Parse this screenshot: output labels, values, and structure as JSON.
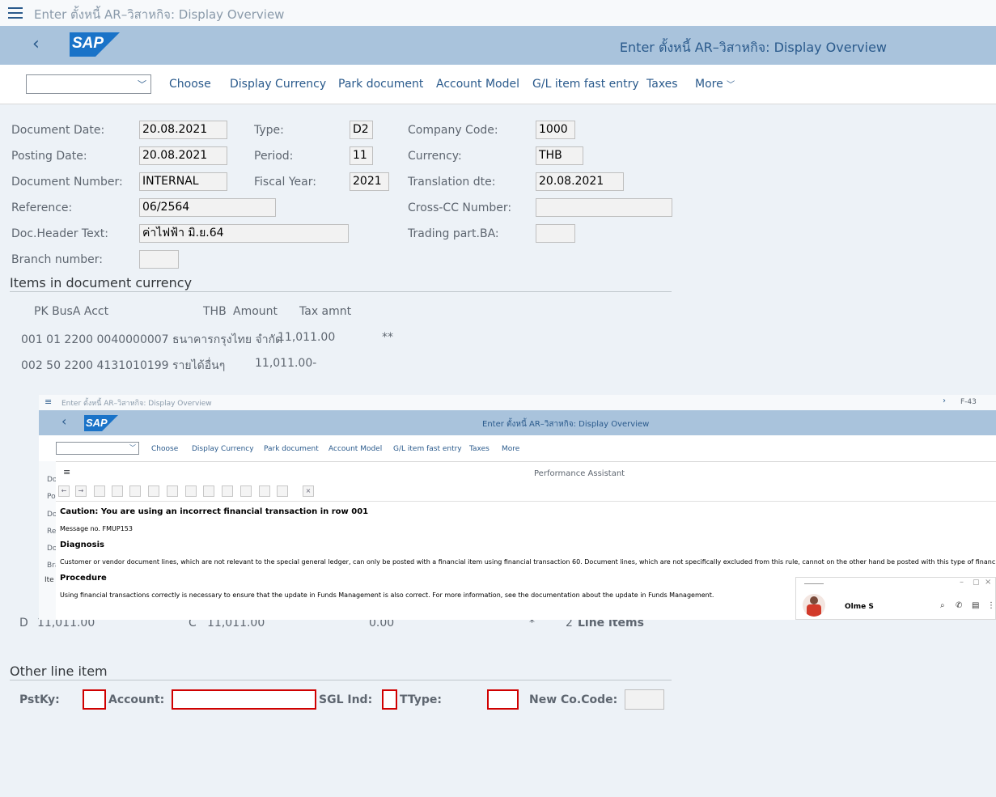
{
  "title_bar": {
    "text": "Enter ตั้งหนี้ AR–วิสาหกิจ: Display Overview"
  },
  "header": {
    "logo": "SAP",
    "title": "Enter ตั้งหนี้ AR–วิสาหกิจ: Display Overview"
  },
  "toolbar": {
    "items": [
      "Choose",
      "Display Currency",
      "Park document",
      "Account Model",
      "G/L item fast entry",
      "Taxes",
      "More"
    ]
  },
  "form": {
    "document_date": {
      "label": "Document Date:",
      "value": "20.08.2021"
    },
    "posting_date": {
      "label": "Posting Date:",
      "value": "20.08.2021"
    },
    "document_number": {
      "label": "Document Number:",
      "value": "INTERNAL"
    },
    "reference": {
      "label": "Reference:",
      "value": "06/2564"
    },
    "doc_header_text": {
      "label": "Doc.Header Text:",
      "value": "ค่าไฟฟ้า มิ.ย.64"
    },
    "branch_number": {
      "label": "Branch number:",
      "value": ""
    },
    "type": {
      "label": "Type:",
      "value": "D2"
    },
    "period": {
      "label": "Period:",
      "value": "11"
    },
    "fiscal_year": {
      "label": "Fiscal Year:",
      "value": "2021"
    },
    "company_code": {
      "label": "Company Code:",
      "value": "1000"
    },
    "currency": {
      "label": "Currency:",
      "value": "THB"
    },
    "translation_dte": {
      "label": "Translation dte:",
      "value": "20.08.2021"
    },
    "cross_cc": {
      "label": "Cross-CC Number:",
      "value": ""
    },
    "trading_part": {
      "label": "Trading part.BA:",
      "value": ""
    }
  },
  "items_section": {
    "title": "Items in document currency",
    "headers": {
      "pk_busa_acct": "PK  BusA Acct",
      "currency": "THB",
      "amount": "Amount",
      "tax": "Tax amnt"
    },
    "rows": [
      {
        "text": "001 01  2200 0040000007 ธนาคารกรุงไทย จำกัด",
        "amount": "11,011.00",
        "flag": "**"
      },
      {
        "text": "002 50  2200 4131010199 รายได้อื่นๆ",
        "amount": "11,011.00-",
        "flag": ""
      }
    ]
  },
  "totals": {
    "d": "D",
    "d_amount": "11,011.00",
    "c": "C",
    "c_amount": "11,011.00",
    "diff": "0.00",
    "star": "*",
    "count": "2",
    "items_label": "Line items"
  },
  "other_line": {
    "title": "Other line item",
    "pstky": "PstKy:",
    "account": "Account:",
    "sgl": "SGL Ind:",
    "ttype": "TType:",
    "new_cc": "New Co.Code:"
  },
  "overlay": {
    "title_bar": "Enter ตั้งหนี้ AR–วิสาหกิจ: Display Overview",
    "right_code": "F-43",
    "header_title": "Enter ตั้งหนี้ AR–วิสาหกิจ: Display Overview",
    "toolbar": [
      "Choose",
      "Display Currency",
      "Park document",
      "Account Model",
      "G/L item fast entry",
      "Taxes",
      "More"
    ],
    "left_labels": [
      "Do",
      "Po",
      "Do",
      "Re",
      "Do",
      "Bra",
      "Ite"
    ],
    "assistant": {
      "title": "Performance Assistant",
      "caution": "Caution: You are using an incorrect financial transaction in row 001",
      "message_no": "Message no. FMUP153",
      "diagnosis_title": "Diagnosis",
      "diagnosis": "Customer or vendor document lines, which are not relevant to the special general ledger, can only be posted with a financial item using financial transaction 60. Document lines, which are not specifically excluded from this rule, cannot on the other hand be posted with this type of financial item.",
      "procedure_title": "Procedure",
      "procedure": "Using financial transactions correctly is necessary to ensure that the update in Funds Management is also correct. For more information, see the documentation about the update in Funds Management."
    },
    "chat": {
      "name": "Olme S"
    }
  }
}
